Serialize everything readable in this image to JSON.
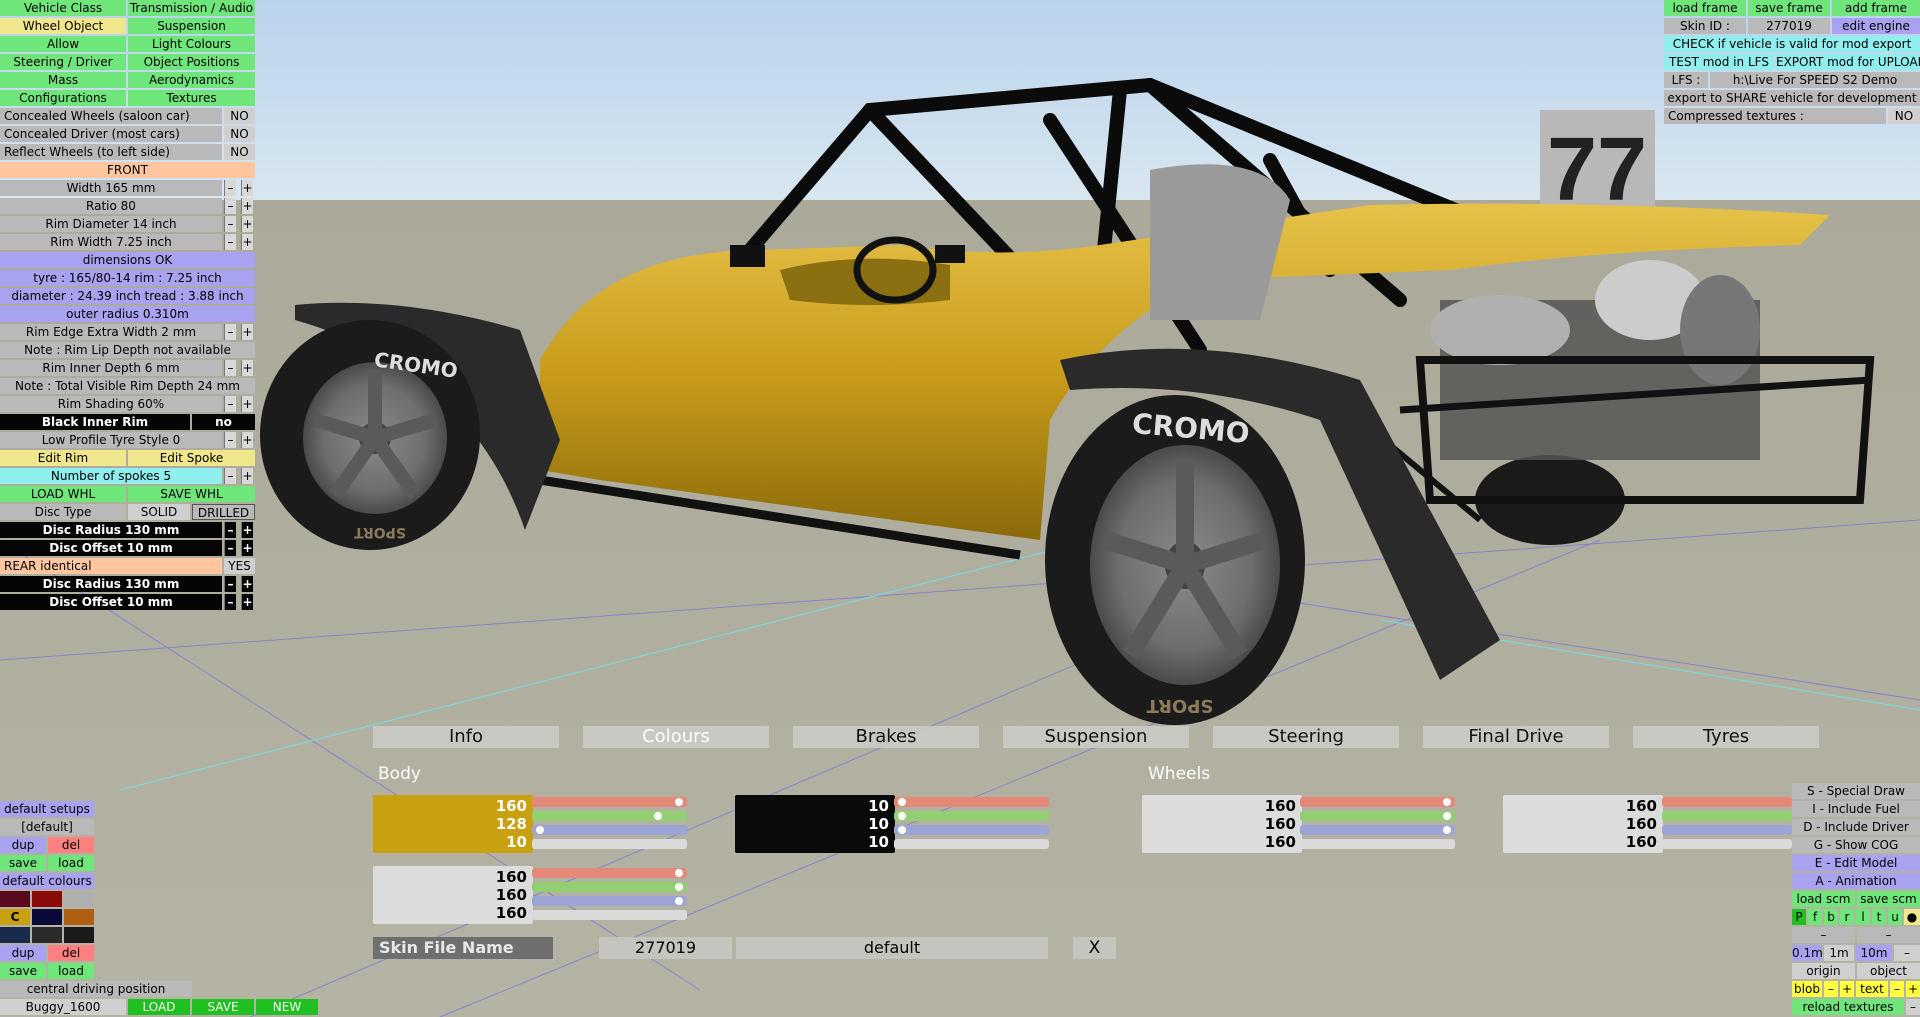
{
  "left_menu": {
    "tabs": [
      "Vehicle Class",
      "Transmission / Audio",
      "Wheel Object",
      "Suspension",
      "Allow",
      "Light Colours",
      "Steering / Driver",
      "Object Positions",
      "Mass",
      "Aerodynamics",
      "Configurations",
      "Textures"
    ],
    "concealed_wheels": {
      "label": "Concealed Wheels (saloon car)",
      "value": "NO"
    },
    "concealed_driver": {
      "label": "Concealed Driver (most cars)",
      "value": "NO"
    },
    "reflect_wheels": {
      "label": "Reflect Wheels (to left side)",
      "value": "NO"
    },
    "front_header": "FRONT",
    "width": "Width 165 mm",
    "ratio": "Ratio 80",
    "rim_diameter": "Rim Diameter 14 inch",
    "rim_width": "Rim Width 7.25 inch",
    "dimensions_ok": "dimensions OK",
    "tyre_info": "tyre : 165/80-14   rim : 7.25 inch",
    "diameter_info": "diameter : 24.39 inch   tread : 3.88 inch",
    "outer_radius": "outer radius 0.310m",
    "rim_edge": "Rim Edge Extra Width 2 mm",
    "note_rim_lip": "Note : Rim Lip Depth not available",
    "rim_inner_depth": "Rim Inner Depth 6 mm",
    "note_total": "Note : Total Visible Rim Depth 24 mm",
    "rim_shading": "Rim Shading 60%",
    "black_inner_rim": {
      "label": "Black Inner Rim",
      "value": "no"
    },
    "low_profile": "Low Profile Tyre Style 0",
    "edit_rim": "Edit Rim",
    "edit_spoke": "Edit Spoke",
    "spokes": "Number of spokes 5",
    "load_whl": "LOAD WHL",
    "save_whl": "SAVE WHL",
    "disc_type": {
      "label": "Disc Type",
      "solid": "SOLID",
      "drilled": "DRILLED"
    },
    "front_disc_radius": "Disc Radius 130 mm",
    "front_disc_offset": "Disc Offset 10 mm",
    "rear_identical": {
      "label": "REAR identical",
      "value": "YES"
    },
    "rear_disc_radius": "Disc Radius 130 mm",
    "rear_disc_offset": "Disc Offset 10 mm",
    "minus": "–",
    "plus": "+"
  },
  "top_right": {
    "load_frame": "load frame",
    "save_frame": "save frame",
    "add_frame": "add frame",
    "skin_id_label": "Skin ID :",
    "skin_id": "277019",
    "edit_engine": "edit engine",
    "check_valid": "CHECK if vehicle is valid for mod export",
    "test_mod": "TEST mod in LFS",
    "export_mod": "EXPORT mod for UPLOAD",
    "lfs_label": "LFS :",
    "lfs_path": "h:\\Live For SPEED S2 Demo",
    "export_share": "export to SHARE vehicle for development",
    "compressed": {
      "label": "Compressed textures :",
      "value": "NO"
    }
  },
  "viewport": {
    "number_plate": "77",
    "tyre_brand": "CROMO",
    "tyre_sub": "SPORT"
  },
  "bottom_tabs": [
    "Info",
    "Colours",
    "Brakes",
    "Suspension",
    "Steering",
    "Final Drive",
    "Tyres"
  ],
  "colours": {
    "body_label": "Body",
    "wheels_label": "Wheels",
    "body_primary": {
      "r": "160",
      "g": "128",
      "b": "10",
      "color": "#c9a010"
    },
    "body_secondary": {
      "r": "10",
      "g": "10",
      "b": "10",
      "color": "#0a0a0a"
    },
    "body_third": {
      "r": "160",
      "g": "160",
      "b": "160",
      "color": "#dcdcdc"
    },
    "wheels_primary": {
      "r": "160",
      "g": "160",
      "b": "160",
      "color": "#dcdcdc"
    },
    "wheels_secondary": {
      "r": "160",
      "g": "160",
      "b": "160",
      "color": "#dcdcdc"
    }
  },
  "skin_file": {
    "label": "Skin File Name",
    "id": "277019",
    "name": "default",
    "close": "X"
  },
  "bottom_left": {
    "default_setups": "default setups",
    "default_bracket": "[default]",
    "dup": "dup",
    "del": "del",
    "save": "save",
    "load": "load",
    "default_colours": "default colours",
    "swatch_c": "C",
    "swatches": [
      "#5a0a1e",
      "#8a0a0a",
      "#b0b0b0",
      "#c9a010",
      "#0a0a3a",
      "#b06010",
      "#1a2a4a",
      "#2a2a2a",
      "#1a1a1a"
    ],
    "central_driving": "central driving position",
    "car_name": "Buggy_1600",
    "load_btn": "LOAD",
    "save_btn": "SAVE",
    "new_btn": "NEW"
  },
  "bottom_right": {
    "special_draw": "S - Special Draw",
    "include_fuel": "I - Include Fuel",
    "include_driver": "D - Include Driver",
    "show_cog": "G - Show COG",
    "edit_model": "E - Edit Model",
    "animation": "A - Animation",
    "load_scm": "load scm",
    "save_scm": "save scm",
    "flags": [
      "P",
      "f",
      "b",
      "r",
      "l",
      "t",
      "u"
    ],
    "dot": "●",
    "dash": "–",
    "scale_01": "0.1m",
    "scale_1": "1m",
    "scale_10": "10m",
    "origin": "origin",
    "object": "object",
    "blob": "blob",
    "text": "text",
    "reload_textures": "reload textures"
  }
}
